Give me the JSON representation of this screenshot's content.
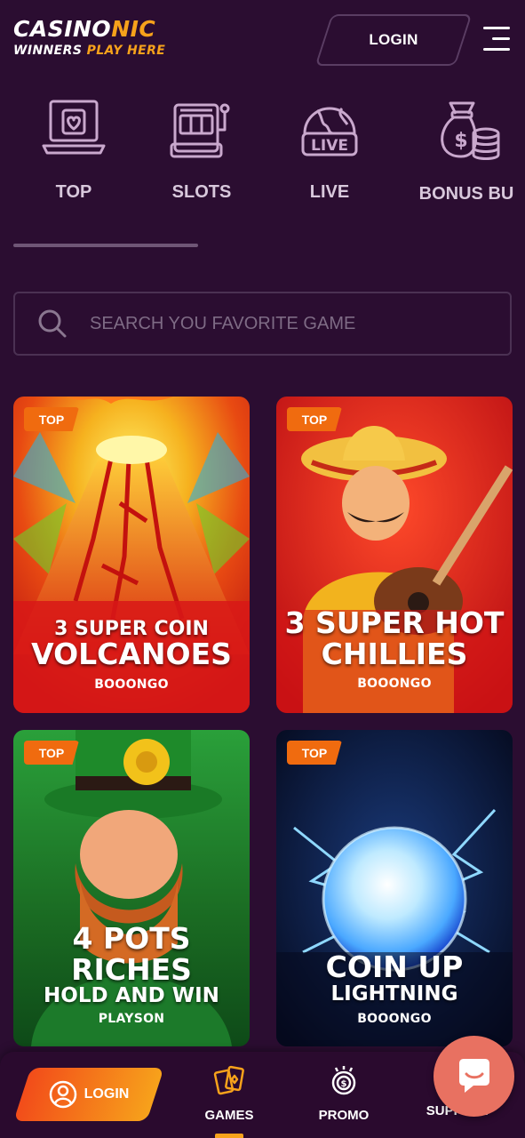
{
  "header": {
    "logo_left": "CASINO",
    "logo_right": "NIC",
    "tagline_left": "WINNERS",
    "tagline_right": "PLAY HERE",
    "login_label": "LOGIN"
  },
  "categories": [
    {
      "label": "TOP",
      "icon": "laptop-heart-icon"
    },
    {
      "label": "SLOTS",
      "icon": "slot-machine-icon"
    },
    {
      "label": "LIVE",
      "icon": "live-globe-icon"
    },
    {
      "label": "BONUS BU",
      "icon": "money-bag-icon"
    }
  ],
  "search": {
    "placeholder": "SEARCH YOU FAVORITE GAME"
  },
  "games": [
    {
      "badge": "TOP",
      "line1": "3 SUPER COIN",
      "line2": "VOLCANOES",
      "provider": "BOOONGO"
    },
    {
      "badge": "TOP",
      "line1": "3 SUPER HOT",
      "line2": "CHILLIES",
      "provider": "BOOONGO"
    },
    {
      "badge": "TOP",
      "line1": "4 POTS",
      "line2": "RICHES",
      "line3": "HOLD AND WIN",
      "provider": "PLAYSON"
    },
    {
      "badge": "TOP",
      "line1": "COIN UP",
      "line2": "LIGHTNING",
      "provider": "BOOONGO"
    }
  ],
  "bottom_nav": {
    "login_label": "LOGIN",
    "games_label": "GAMES",
    "promo_label": "PROMO",
    "support_label": "SUPPORT"
  },
  "colors": {
    "background": "#2b0d31",
    "accent": "#f7a21b",
    "badge": "#f06b0f",
    "chat": "#e87161"
  }
}
